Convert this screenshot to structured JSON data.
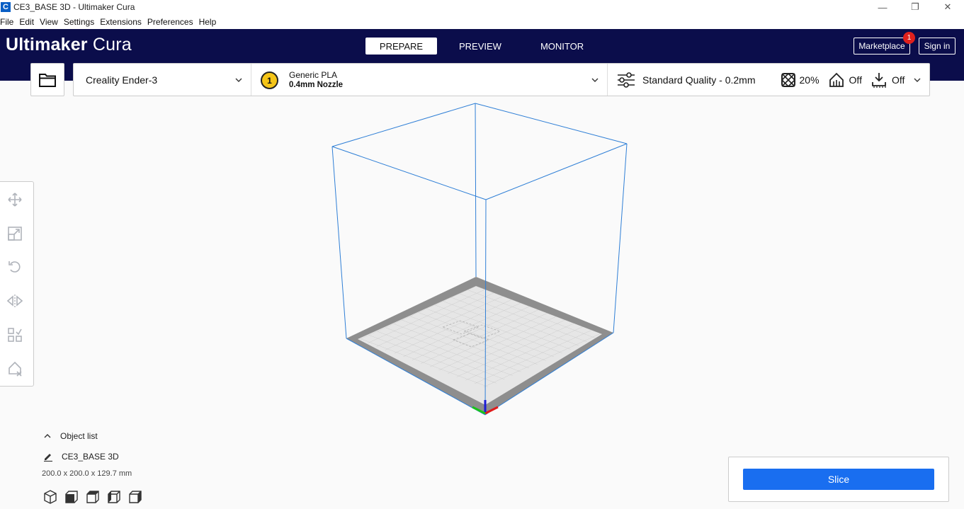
{
  "window": {
    "title": "CE3_BASE 3D - Ultimaker Cura",
    "app_icon_letter": "C",
    "controls": {
      "minimize": "—",
      "restore": "❐",
      "close": "✕"
    }
  },
  "menubar": {
    "items": [
      "File",
      "Edit",
      "View",
      "Settings",
      "Extensions",
      "Preferences",
      "Help"
    ]
  },
  "header": {
    "brand_bold": "Ultimaker",
    "brand_light": "Cura",
    "stages": [
      "PREPARE",
      "PREVIEW",
      "MONITOR"
    ],
    "active_stage": "PREPARE",
    "marketplace_label": "Marketplace",
    "marketplace_badge": "1",
    "signin_label": "Sign in",
    "background_color": "#0b0d4b"
  },
  "toolbar": {
    "open_icon": "folder-icon",
    "printer": "Creality Ender-3",
    "extruder_number": "1",
    "material_name": "Generic PLA",
    "nozzle": "0.4mm Nozzle",
    "quality": "Standard Quality - 0.2mm",
    "infill": "20%",
    "support": "Off",
    "adhesion": "Off"
  },
  "tools": [
    "move-icon",
    "scale-icon",
    "rotate-icon",
    "mirror-icon",
    "per-model-settings-icon",
    "support-blocker-icon"
  ],
  "object_list": {
    "toggle_label": "Object list",
    "object_name": "CE3_BASE 3D",
    "dimensions": "200.0 x 200.0 x 129.7 mm"
  },
  "view_buttons": [
    "3d-view-icon",
    "front-view-icon",
    "top-view-icon",
    "left-view-icon",
    "right-view-icon"
  ],
  "action": {
    "slice_label": "Slice",
    "accent_color": "#196ef0"
  }
}
